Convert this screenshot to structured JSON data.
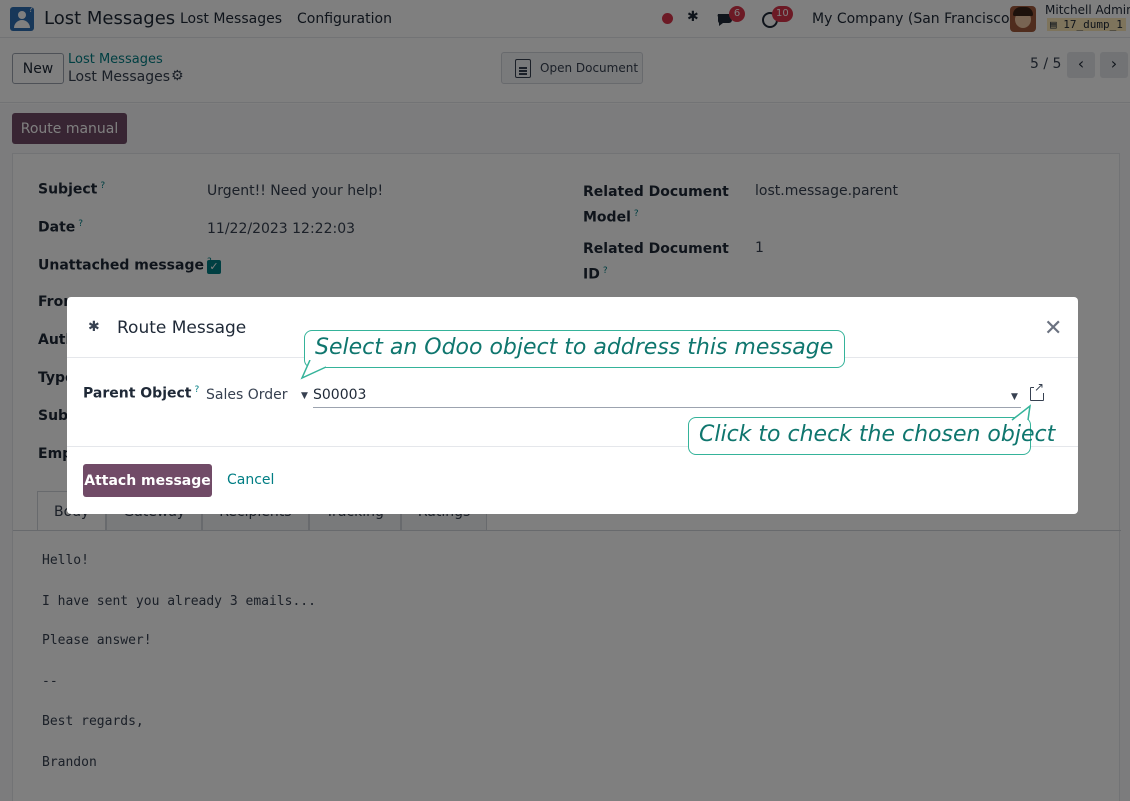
{
  "navbar": {
    "app_title": "Lost Messages",
    "menu": [
      "Lost Messages",
      "Configuration"
    ],
    "chat_badge": "6",
    "activity_badge": "10",
    "company": "My Company (San Francisco)",
    "user_name": "Mitchell Admin",
    "db_name": "17_dump_1"
  },
  "control": {
    "new_label": "New",
    "breadcrumb_parent": "Lost Messages",
    "breadcrumb_current": "Lost Messages",
    "open_document_label": "Open Document",
    "pager": "5 / 5"
  },
  "form": {
    "route_manual_label": "Route manual",
    "fields_left": [
      {
        "label": "Subject",
        "value": "Urgent!! Need your help!"
      },
      {
        "label": "Date",
        "value": "11/22/2023 12:22:03"
      },
      {
        "label": "Unattached message",
        "value": ""
      },
      {
        "label": "From"
      },
      {
        "label": "Auth"
      },
      {
        "label": "Type"
      },
      {
        "label": "Subj"
      },
      {
        "label": "Emp"
      }
    ],
    "fields_right": [
      {
        "label_line1": "Related Document",
        "label_line2": "Model",
        "value": "lost.message.parent"
      },
      {
        "label_line1": "Related Document",
        "label_line2": "ID",
        "value": "1"
      }
    ],
    "help_mark": "?",
    "unattached_checked": true,
    "tabs": [
      "Body",
      "Gateway",
      "Recipients",
      "Tracking",
      "Ratings"
    ],
    "body_lines": [
      "Hello!",
      "I have sent you already 3 emails...",
      "Please answer!",
      "--",
      "Best regards,",
      "Brandon"
    ]
  },
  "modal": {
    "title": "Route Message",
    "parent_object_label": "Parent Object",
    "model_value": "Sales Order",
    "record_value": "S00003",
    "attach_label": "Attach message",
    "cancel_label": "Cancel"
  },
  "callouts": {
    "top": "Select an Odoo object to address this message",
    "bottom": "Click to check the chosen object"
  },
  "colors": {
    "primary": "#714b67",
    "link": "#017e84",
    "badge": "#d9344a",
    "callout_border": "#35b39a"
  }
}
